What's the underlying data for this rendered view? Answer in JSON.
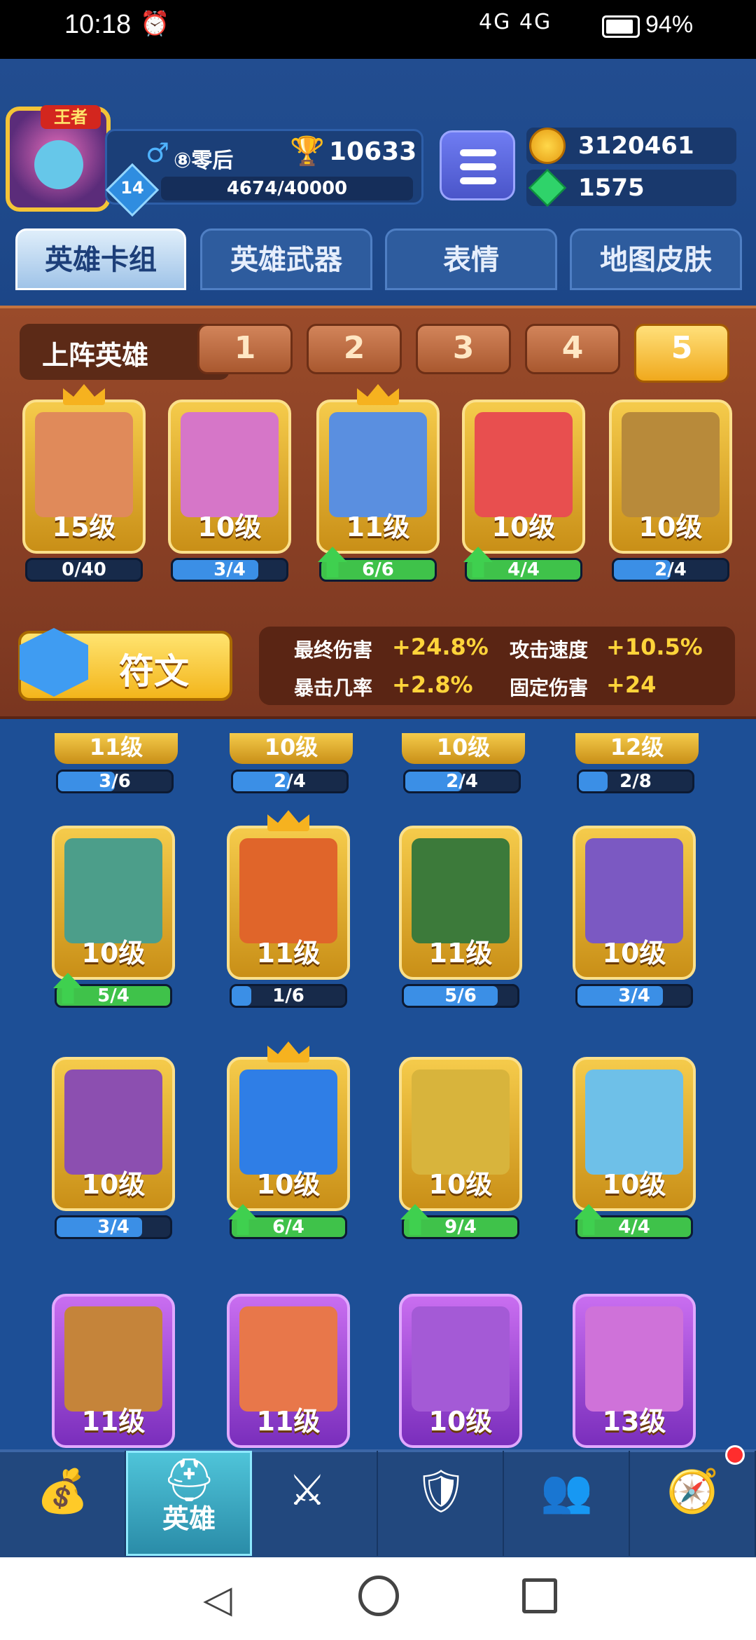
{
  "status": {
    "time": "10:18",
    "alarm": "⏰",
    "network": "4G 4G",
    "battery": "94%"
  },
  "profile": {
    "title_badge": "王者",
    "name": "⑧零后",
    "trophies": "10633",
    "level": "14",
    "xp": "4674/40000"
  },
  "currency": {
    "coins": "3120461",
    "gems": "1575"
  },
  "tabs": [
    "英雄卡组",
    "英雄武器",
    "表情",
    "地图皮肤"
  ],
  "lineup": {
    "label": "上阵英雄",
    "slots": [
      "1",
      "2",
      "3",
      "4",
      "5"
    ],
    "active_slot": "5",
    "cards": [
      {
        "level": "15级",
        "progress": "0/40",
        "fill": 0.0,
        "bar": "blue",
        "upgrade": false,
        "crown": true,
        "art": "#e08a5a"
      },
      {
        "level": "10级",
        "progress": "3/4",
        "fill": 0.75,
        "bar": "blue",
        "upgrade": false,
        "crown": false,
        "art": "#d676c8"
      },
      {
        "level": "11级",
        "progress": "6/6",
        "fill": 1.0,
        "bar": "green",
        "upgrade": true,
        "crown": true,
        "art": "#5a8fe0"
      },
      {
        "level": "10级",
        "progress": "4/4",
        "fill": 1.0,
        "bar": "green",
        "upgrade": true,
        "crown": false,
        "art": "#e84f4f"
      },
      {
        "level": "10级",
        "progress": "2/4",
        "fill": 0.5,
        "bar": "blue",
        "upgrade": false,
        "crown": false,
        "art": "#b88a3a"
      }
    ]
  },
  "rune": {
    "label": "符文"
  },
  "stats": [
    {
      "label": "最终伤害",
      "value": "+24.8%"
    },
    {
      "label": "攻击速度",
      "value": "+10.5%"
    },
    {
      "label": "暴击几率",
      "value": "+2.8%"
    },
    {
      "label": "固定伤害",
      "value": "+24"
    }
  ],
  "collection_partial": [
    {
      "level": "11级",
      "progress": "3/6",
      "fill": 0.5
    },
    {
      "level": "10级",
      "progress": "2/4",
      "fill": 0.5
    },
    {
      "level": "10级",
      "progress": "2/4",
      "fill": 0.5
    },
    {
      "level": "12级",
      "progress": "2/8",
      "fill": 0.25
    }
  ],
  "collection": [
    {
      "level": "10级",
      "progress": "5/4",
      "fill": 1.0,
      "bar": "green",
      "upgrade": true,
      "crown": false,
      "art": "#4c9e8a"
    },
    {
      "level": "11级",
      "progress": "1/6",
      "fill": 0.17,
      "bar": "blue",
      "upgrade": false,
      "crown": true,
      "art": "#e0652a"
    },
    {
      "level": "11级",
      "progress": "5/6",
      "fill": 0.83,
      "bar": "blue",
      "upgrade": false,
      "crown": false,
      "art": "#3c7a3a"
    },
    {
      "level": "10级",
      "progress": "3/4",
      "fill": 0.75,
      "bar": "blue",
      "upgrade": false,
      "crown": false,
      "art": "#7b59c2"
    },
    {
      "level": "10级",
      "progress": "3/4",
      "fill": 0.75,
      "bar": "blue",
      "upgrade": false,
      "crown": false,
      "art": "#8c4fb0"
    },
    {
      "level": "10级",
      "progress": "6/4",
      "fill": 1.0,
      "bar": "green",
      "upgrade": true,
      "crown": true,
      "art": "#2f7ee6"
    },
    {
      "level": "10级",
      "progress": "9/4",
      "fill": 1.0,
      "bar": "green",
      "upgrade": true,
      "crown": false,
      "art": "#d8b43c"
    },
    {
      "level": "10级",
      "progress": "4/4",
      "fill": 1.0,
      "bar": "green",
      "upgrade": true,
      "crown": false,
      "art": "#6ec0e8"
    }
  ],
  "collection_purple": [
    {
      "level": "11级",
      "art": "#c5843a"
    },
    {
      "level": "11级",
      "art": "#e8774a"
    },
    {
      "level": "10级",
      "art": "#a45ad6"
    },
    {
      "level": "13级",
      "art": "#cf72d9"
    }
  ],
  "nav": [
    {
      "icon": "treasure-chest-icon",
      "label": ""
    },
    {
      "icon": "knight-helmet-icon",
      "label": "英雄"
    },
    {
      "icon": "crossed-swords-icon",
      "label": ""
    },
    {
      "icon": "shield-crown-icon",
      "label": ""
    },
    {
      "icon": "team-icon",
      "label": ""
    },
    {
      "icon": "compass-icon",
      "label": ""
    }
  ],
  "colors": {
    "accent": "#f3b51b",
    "green_bar": "#3fc24a",
    "blue_bar": "#3b8fe6",
    "background": "#1d4f96"
  }
}
